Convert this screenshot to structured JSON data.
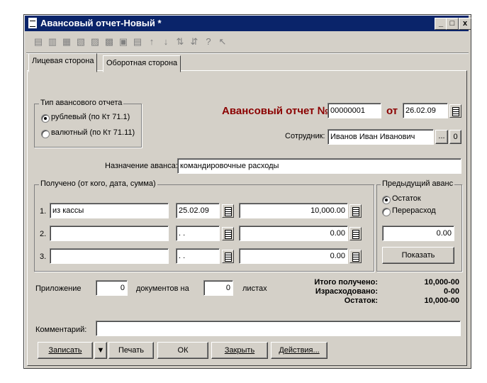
{
  "window": {
    "title": "Авансовый отчет-Новый *",
    "min": "_",
    "max": "□",
    "close": "x"
  },
  "tabs": [
    {
      "label": "Лицевая сторона"
    },
    {
      "label": "Оборотная сторона"
    }
  ],
  "report_type": {
    "group_label": "Тип авансового отчета",
    "options": [
      {
        "label": "рублевый (по Кт 71.1)",
        "selected": true
      },
      {
        "label": "валютный (по Кт 71.11)",
        "selected": false
      }
    ]
  },
  "header": {
    "title": "Авансовый отчет №",
    "number": "00000001",
    "from_label": "от",
    "date": "26.02.09"
  },
  "employee": {
    "label": "Сотрудник:",
    "value": "Иванов Иван Иванович",
    "ellipsis": "...",
    "clear": "0"
  },
  "purpose": {
    "label": "Назначение аванса:",
    "value": "командировочные расходы"
  },
  "received": {
    "group_label": "Получено (от кого, дата, сумма)",
    "rows": [
      {
        "num": "1.",
        "from": "из кассы",
        "date": "25.02.09",
        "amount": "10,000.00"
      },
      {
        "num": "2.",
        "from": "",
        "date": ". .",
        "amount": "0.00"
      },
      {
        "num": "3.",
        "from": "",
        "date": ". .",
        "amount": "0.00"
      }
    ]
  },
  "prev_advance": {
    "group_label": "Предыдущий аванс",
    "options": [
      {
        "label": "Остаток",
        "selected": true
      },
      {
        "label": "Перерасход",
        "selected": false
      }
    ],
    "value": "0.00",
    "show_button": "Показать"
  },
  "attachment": {
    "label": "Приложение",
    "docs": "0",
    "docs_label": "документов на",
    "sheets": "0",
    "sheets_label": "листах"
  },
  "totals": {
    "received_label": "Итого получено:",
    "received": "10,000-00",
    "spent_label": "Израсходовано:",
    "spent": "0-00",
    "balance_label": "Остаток:",
    "balance": "10,000-00"
  },
  "comment": {
    "label": "Комментарий:",
    "value": ""
  },
  "buttons": {
    "save": "Записать",
    "print": "Печать",
    "ok": "ОК",
    "close": "Закрыть",
    "actions": "Действия..."
  }
}
